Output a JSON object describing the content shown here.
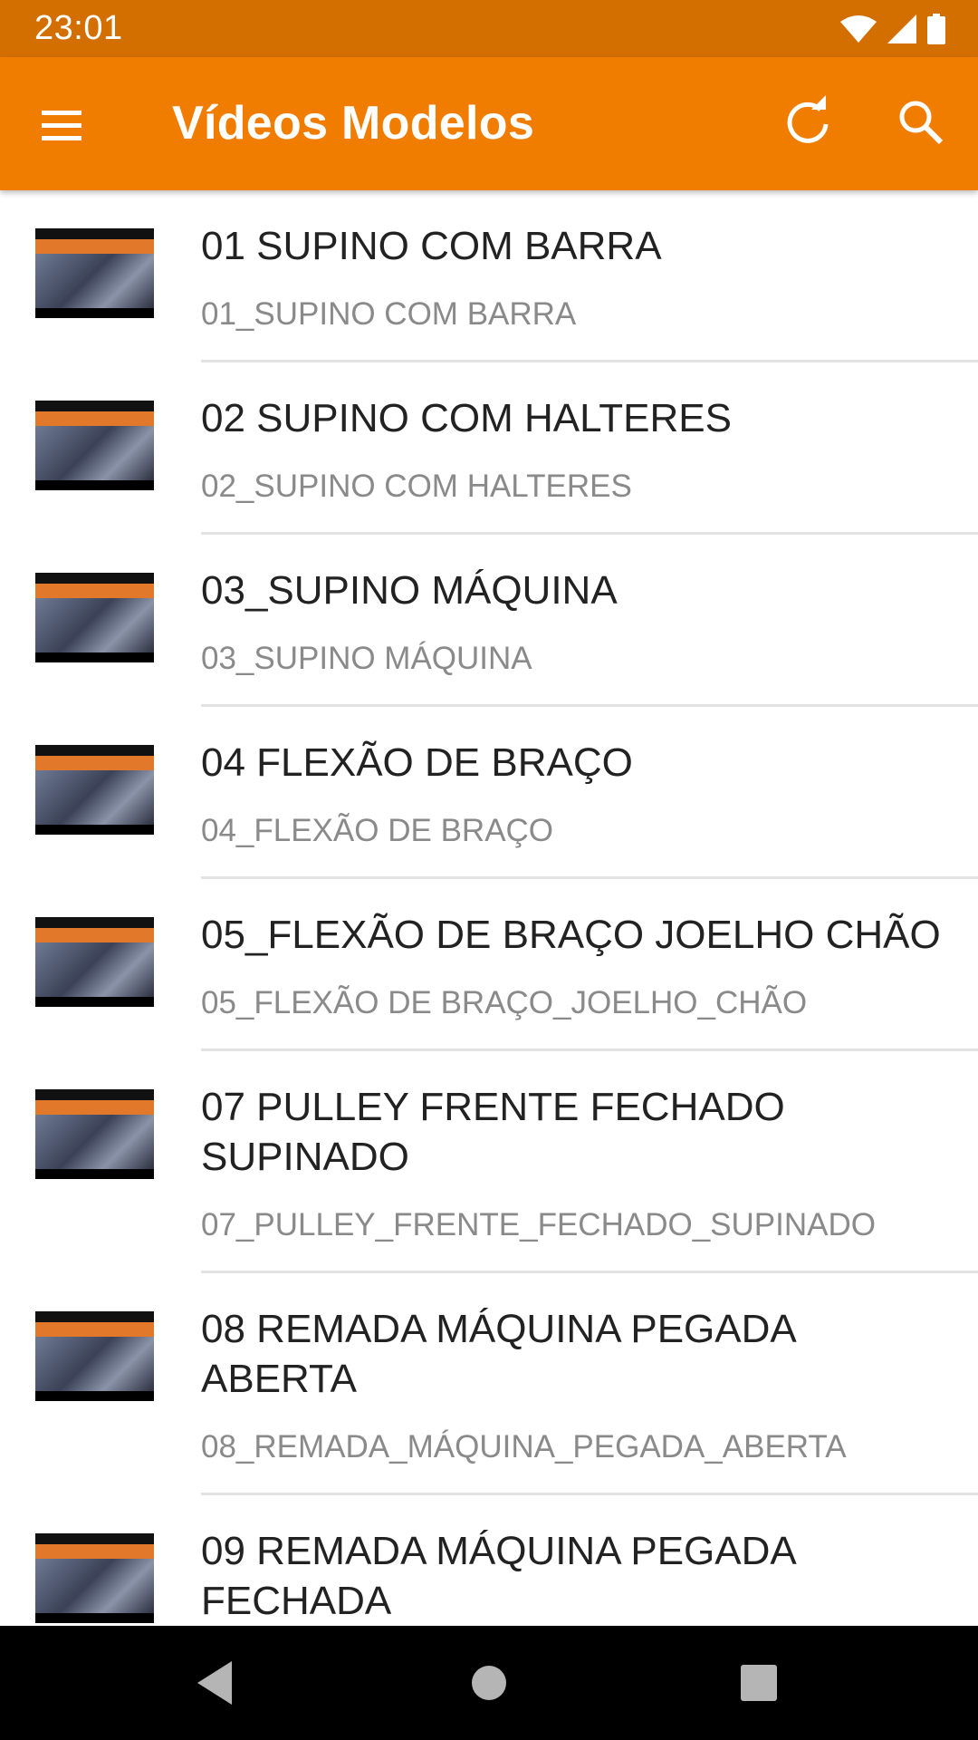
{
  "status_bar": {
    "time": "23:01",
    "icons": [
      "wifi-icon",
      "signal-icon",
      "battery-icon"
    ]
  },
  "app_bar": {
    "title": "Vídeos Modelos",
    "background": "#f07d00",
    "status_color": "#d36f00",
    "icons": [
      "menu-icon",
      "refresh-icon",
      "search-icon"
    ]
  },
  "videos": [
    {
      "title": "01 SUPINO COM BARRA",
      "subtitle": "01_SUPINO COM BARRA"
    },
    {
      "title": "02 SUPINO COM HALTERES",
      "subtitle": "02_SUPINO COM HALTERES"
    },
    {
      "title": "03_SUPINO MÁQUINA",
      "subtitle": "03_SUPINO MÁQUINA"
    },
    {
      "title": "04 FLEXÃO DE BRAÇO",
      "subtitle": "04_FLEXÃO DE BRAÇO"
    },
    {
      "title": "05_FLEXÃO DE BRAÇO JOELHO CHÃO",
      "subtitle": "05_FLEXÃO DE BRAÇO_JOELHO_CHÃO"
    },
    {
      "title": "07 PULLEY FRENTE FECHADO SUPINADO",
      "subtitle": "07_PULLEY_FRENTE_FECHADO_SUPINADO"
    },
    {
      "title": "08 REMADA MÁQUINA PEGADA ABERTA",
      "subtitle": "08_REMADA_MÁQUINA_PEGADA_ABERTA"
    },
    {
      "title": "09 REMADA MÁQUINA PEGADA FECHADA",
      "subtitle": ""
    }
  ],
  "nav_bar": {
    "icons": [
      "back-icon",
      "home-icon",
      "recents-icon"
    ]
  }
}
